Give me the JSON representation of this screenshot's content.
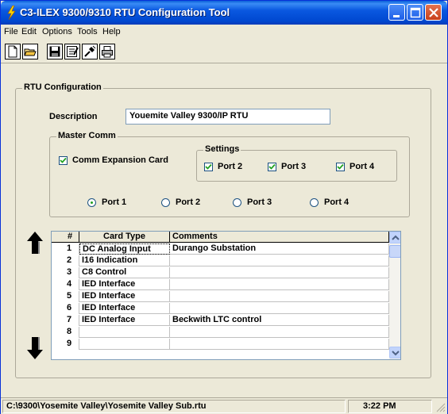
{
  "window": {
    "title": "C3-ILEX 9300/9310 RTU Configuration Tool"
  },
  "menu": {
    "items": [
      "File",
      "Edit",
      "Options",
      "Tools",
      "Help"
    ]
  },
  "toolbar": {
    "icons": [
      "new-file-icon",
      "open-folder-icon",
      "save-icon",
      "properties-icon",
      "connect-plug-icon",
      "print-icon"
    ]
  },
  "rtu_config": {
    "group_label": "RTU Configuration",
    "description_label": "Description",
    "description_value": "Youemite Valley 9300/IP RTU",
    "master_comm": {
      "group_label": "Master Comm",
      "comm_expansion_label": "Comm Expansion Card",
      "comm_expansion_checked": true,
      "settings": {
        "group_label": "Settings",
        "ports": [
          {
            "label": "Port 2",
            "checked": true
          },
          {
            "label": "Port 3",
            "checked": true
          },
          {
            "label": "Port 4",
            "checked": true
          }
        ]
      },
      "radio_ports": [
        {
          "label": "Port 1",
          "selected": true
        },
        {
          "label": "Port 2",
          "selected": false
        },
        {
          "label": "Port 3",
          "selected": false
        },
        {
          "label": "Port 4",
          "selected": false
        }
      ]
    }
  },
  "grid": {
    "headers": [
      "#",
      "Card Type",
      "Comments"
    ],
    "rows": [
      {
        "num": "1",
        "type": "DC Analog Input",
        "comment": "Durango Substation"
      },
      {
        "num": "2",
        "type": "I16 Indication",
        "comment": ""
      },
      {
        "num": "3",
        "type": "C8 Control",
        "comment": ""
      },
      {
        "num": "4",
        "type": "IED Interface",
        "comment": ""
      },
      {
        "num": "5",
        "type": "IED Interface",
        "comment": ""
      },
      {
        "num": "6",
        "type": "IED Interface",
        "comment": ""
      },
      {
        "num": "7",
        "type": "IED Interface",
        "comment": "Beckwith LTC control"
      },
      {
        "num": "8",
        "type": "",
        "comment": ""
      },
      {
        "num": "9",
        "type": "",
        "comment": ""
      }
    ]
  },
  "status": {
    "path": "C:\\9300\\Yosemite Valley\\Yosemite Valley Sub.rtu",
    "time": "3:22 PM"
  },
  "colors": {
    "titlebar": "#0a58e0",
    "face": "#ece9d8",
    "check": "#21a121"
  }
}
